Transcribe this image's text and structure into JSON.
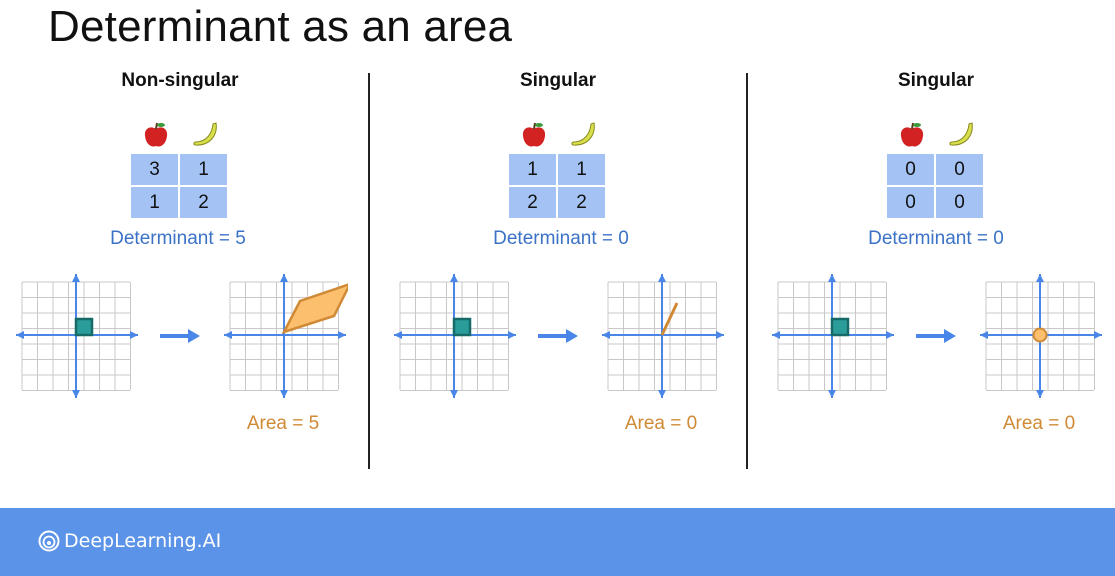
{
  "title": "Determinant as an area",
  "panels": [
    {
      "heading": "Non-singular",
      "matrix": [
        [
          "3",
          "1"
        ],
        [
          "1",
          "2"
        ]
      ],
      "determinant_label": "Determinant = 5",
      "area_label": "Area = 5"
    },
    {
      "heading": "Singular",
      "matrix": [
        [
          "1",
          "1"
        ],
        [
          "2",
          "2"
        ]
      ],
      "determinant_label": "Determinant = 0",
      "area_label": "Area = 0"
    },
    {
      "heading": "Singular",
      "matrix": [
        [
          "0",
          "0"
        ],
        [
          "0",
          "0"
        ]
      ],
      "determinant_label": "Determinant = 0",
      "area_label": "Area = 0"
    }
  ],
  "footer": {
    "logo_text": "DeepLearning.AI"
  },
  "colors": {
    "axis": "#4a86e8",
    "grid": "#c8c8c8",
    "unit_square": "#2a9d9b",
    "image_fill": "#fbbf6e",
    "image_stroke": "#d08a35",
    "matrix_cell": "#a4c2f4",
    "footer": "#5b93e8"
  },
  "icons": [
    "apple-icon",
    "banana-icon",
    "right-arrow-icon",
    "deeplearning-logo-icon"
  ]
}
